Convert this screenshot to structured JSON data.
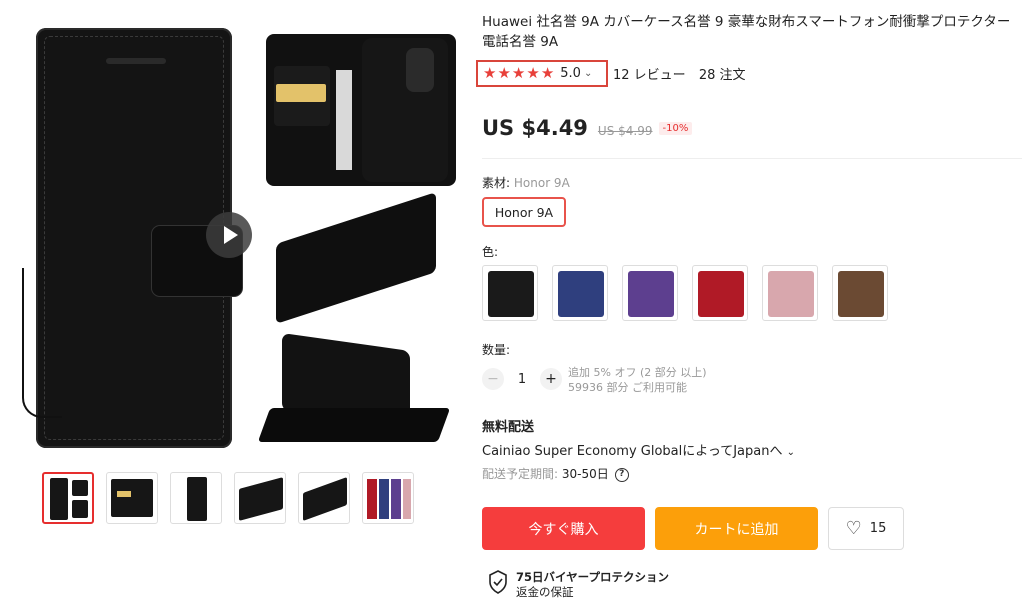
{
  "product": {
    "title": "Huawei 社名誉 9A カバーケース名誉 9 豪華な財布スマートフォン耐衝撃プロテクター電話名誉 9A",
    "rating": {
      "stars": 5,
      "value": "5.0",
      "reviews": "12 レビュー",
      "orders": "28 注文"
    },
    "price": {
      "current": "US $4.49",
      "original": "US $4.99",
      "discount": "-10%"
    },
    "material": {
      "label": "素材:",
      "selected": "Honor 9A",
      "option": "Honor 9A"
    },
    "color": {
      "label": "色:",
      "swatches": [
        {
          "name": "black",
          "hex": "#1a1a1a"
        },
        {
          "name": "navy",
          "hex": "#2f3f7e"
        },
        {
          "name": "purple",
          "hex": "#5d3f8f"
        },
        {
          "name": "red",
          "hex": "#b01a26"
        },
        {
          "name": "pink",
          "hex": "#d8a7ad"
        },
        {
          "name": "brown",
          "hex": "#6b4a33"
        }
      ]
    },
    "quantity": {
      "label": "数量:",
      "value": "1",
      "minus": "−",
      "plus": "+",
      "note1": "追加 5% オフ (2 部分 以上)",
      "note2": "59936 部分 ご利用可能"
    },
    "shipping": {
      "heading": "無料配送",
      "method": "Cainiao Super Economy GlobalによってJapanへ",
      "chevron": "⌄",
      "delivery_label": "配送予定期間:",
      "delivery_value": "30-50日"
    },
    "actions": {
      "buy": "今すぐ購入",
      "cart": "カートに追加",
      "wish_count": "15"
    },
    "protection": {
      "title": "75日バイヤープロテクション",
      "subtitle": "返金の保証"
    }
  },
  "colors": {
    "accent": "#e62e2e",
    "buy": "#f53d3d",
    "cart": "#fc9f0a",
    "star": "#e8403a"
  }
}
